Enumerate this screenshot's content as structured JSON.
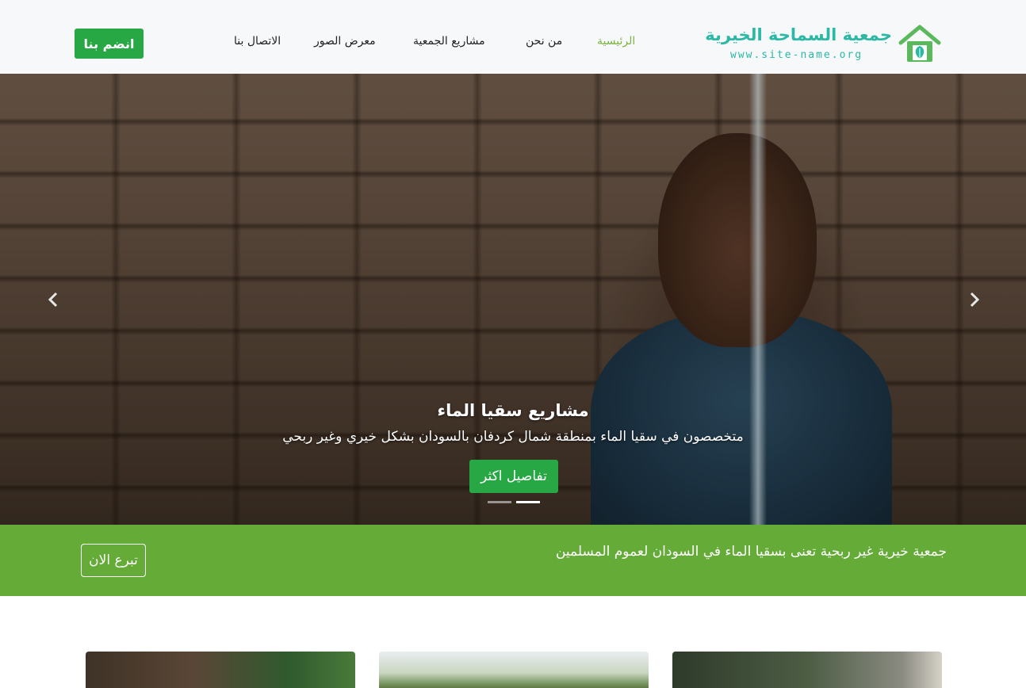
{
  "header": {
    "join_button": "انضم بنا",
    "nav": [
      {
        "label": "الرئيسية",
        "active": true
      },
      {
        "label": "من نحن",
        "active": false
      },
      {
        "label": "مشاريع الجمعية",
        "active": false
      },
      {
        "label": "معرض الصور",
        "active": false
      },
      {
        "label": "الاتصال بنا",
        "active": false
      }
    ],
    "logo": {
      "title": "جمعية السماحة الخيرية",
      "url": "www.site-name.org",
      "icon": "house-leaf-icon"
    }
  },
  "hero": {
    "title": "مشاريع سقيا الماء",
    "subtitle": "متخصصون في سقيا الماء بمنطقة شمال كردفان بالسودان بشكل خيري وغير ربحي",
    "button": "تفاصيل اكثر",
    "prev_icon": "chevron-left-icon",
    "next_icon": "chevron-right-icon",
    "slides_total": 2,
    "active_slide": 2
  },
  "band": {
    "text": "جمعية خيرية غير ربحية تعنى بسقيا الماء في السودان لعموم المسلمين",
    "button": "تبرع الان"
  },
  "colors": {
    "accent_green": "#28a745",
    "band_green": "#64ab38",
    "nav_active": "#7cb342",
    "logo_teal": "#2bb8a4"
  }
}
